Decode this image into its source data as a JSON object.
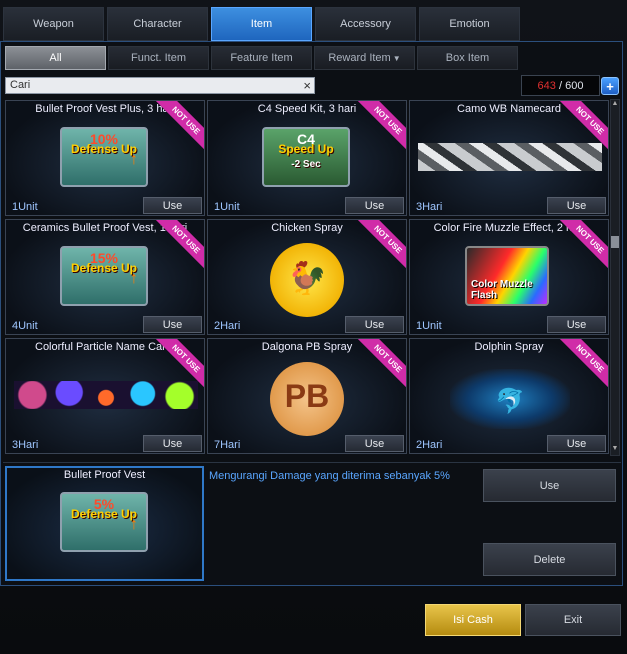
{
  "tabs": [
    {
      "label": "Weapon",
      "active": false
    },
    {
      "label": "Character",
      "active": false
    },
    {
      "label": "Item",
      "active": true
    },
    {
      "label": "Accessory",
      "active": false
    },
    {
      "label": "Emotion",
      "active": false
    }
  ],
  "subtabs": [
    {
      "label": "All",
      "active": true
    },
    {
      "label": "Funct. Item",
      "active": false
    },
    {
      "label": "Feature Item",
      "active": false
    },
    {
      "label": "Reward Item",
      "active": false,
      "dropdown": true
    },
    {
      "label": "Box Item",
      "active": false
    }
  ],
  "search": {
    "value": "Cari"
  },
  "counter": {
    "current": "643",
    "max": "/ 600"
  },
  "badge": "NOT USE",
  "use_label": "Use",
  "items": [
    {
      "name": "Bullet Proof Vest Plus, 3 hari",
      "qty": "1Unit",
      "icon": "vest-icon",
      "pct": "10%",
      "text": "Defense Up"
    },
    {
      "name": "C4 Speed Kit, 3 hari",
      "qty": "1Unit",
      "icon": "c4-icon",
      "text": "C4",
      "sub": "Speed Up",
      "sub2": "-2 Sec"
    },
    {
      "name": "Camo WB Namecard",
      "qty": "3Hari",
      "icon": "camo-icon"
    },
    {
      "name": "Ceramics Bullet Proof Vest, 1 hari",
      "qty": "4Unit",
      "icon": "vest-icon",
      "pct": "15%",
      "text": "Defense Up"
    },
    {
      "name": "Chicken Spray",
      "qty": "2Hari",
      "icon": "chicken-icon"
    },
    {
      "name": "Color Fire Muzzle Effect, 2 hari",
      "qty": "1Unit",
      "icon": "muzzle-icon",
      "text": "Color Muzzle Flash"
    },
    {
      "name": "Colorful Particle Name Card.",
      "qty": "3Hari",
      "icon": "particle-icon"
    },
    {
      "name": "Dalgona PB Spray",
      "qty": "7Hari",
      "icon": "dalgona-icon"
    },
    {
      "name": "Dolphin Spray",
      "qty": "2Hari",
      "icon": "dolphin-icon"
    }
  ],
  "selected": {
    "name": "Bullet Proof Vest",
    "pct": "5%",
    "text": "Defense Up",
    "description": "Mengurangi Damage yang diterima sebanyak 5%"
  },
  "actions": {
    "use": "Use",
    "delete": "Delete",
    "isi_cash": "Isi Cash",
    "exit": "Exit"
  },
  "colors": {
    "accent": "#2f78c8",
    "badge": "#d02ca8",
    "gold": "#d4a82a"
  }
}
